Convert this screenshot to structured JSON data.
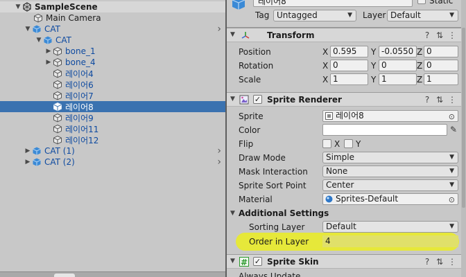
{
  "hierarchy": {
    "scene": "SampleScene",
    "items": [
      {
        "label": "Main Camera",
        "prefab": false
      },
      {
        "label": "CAT",
        "prefab": true
      },
      {
        "label": "CAT",
        "prefab": true
      },
      {
        "label": "bone_1",
        "prefab": true
      },
      {
        "label": "bone_4",
        "prefab": true
      },
      {
        "label": "레이어4",
        "prefab": true
      },
      {
        "label": "레이어6",
        "prefab": true
      },
      {
        "label": "레이어7",
        "prefab": true
      },
      {
        "label": "레이어8",
        "prefab": true
      },
      {
        "label": "레이어9",
        "prefab": true
      },
      {
        "label": "레이어11",
        "prefab": true
      },
      {
        "label": "레이어12",
        "prefab": true
      },
      {
        "label": "CAT (1)",
        "prefab": true
      },
      {
        "label": "CAT (2)",
        "prefab": true
      }
    ]
  },
  "inspector": {
    "object_name": "레이어8",
    "static_label": "Static",
    "tag_label": "Tag",
    "tag_value": "Untagged",
    "layer_label": "Layer",
    "layer_value": "Default",
    "transform": {
      "title": "Transform",
      "position": {
        "label": "Position",
        "x": "0.595",
        "y": "-0.0550",
        "z": "0"
      },
      "rotation": {
        "label": "Rotation",
        "x": "0",
        "y": "0",
        "z": "0"
      },
      "scale": {
        "label": "Scale",
        "x": "1",
        "y": "1",
        "z": "1"
      }
    },
    "sprite_renderer": {
      "title": "Sprite Renderer",
      "sprite_label": "Sprite",
      "sprite_value": "레이어8",
      "color_label": "Color",
      "color_value": "#ffffff",
      "flip_label": "Flip",
      "flip_x": "X",
      "flip_y": "Y",
      "draw_mode_label": "Draw Mode",
      "draw_mode_value": "Simple",
      "mask_label": "Mask Interaction",
      "mask_value": "None",
      "sort_point_label": "Sprite Sort Point",
      "sort_point_value": "Center",
      "material_label": "Material",
      "material_value": "Sprites-Default",
      "additional_label": "Additional Settings",
      "sorting_layer_label": "Sorting Layer",
      "sorting_layer_value": "Default",
      "order_label": "Order in Layer",
      "order_value": "4"
    },
    "sprite_skin": {
      "title": "Sprite Skin",
      "next_label": "Always Update"
    },
    "axis": {
      "x": "X",
      "y": "Y",
      "z": "Z"
    }
  },
  "colors": {
    "selection": "#3a72b0",
    "prefab_text": "#0e4aa0",
    "highlight": "#e8ea2e"
  }
}
